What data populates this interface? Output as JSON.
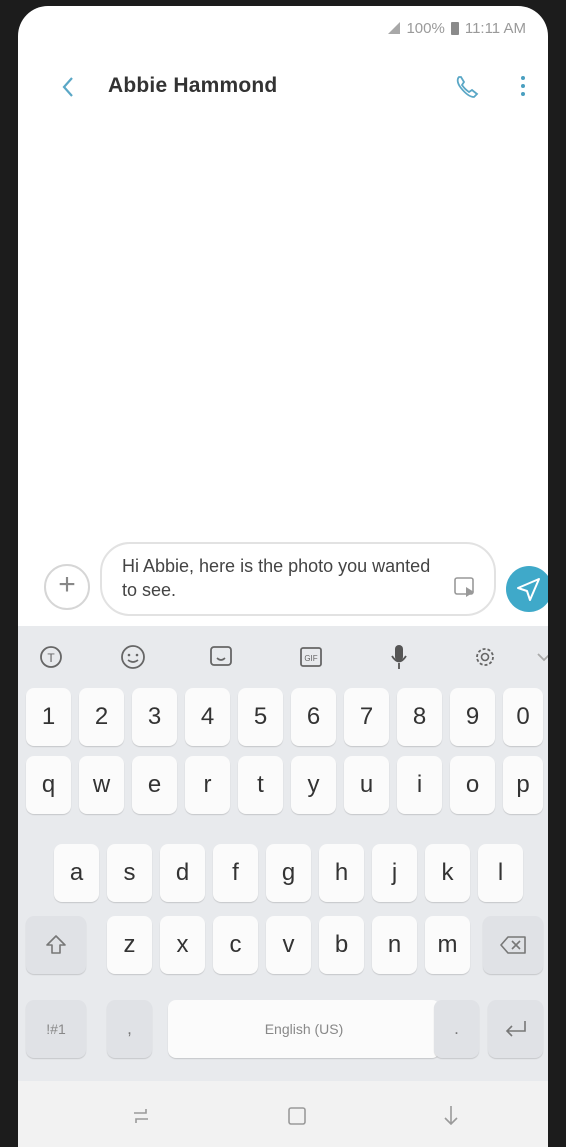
{
  "status_bar": {
    "battery": "100%",
    "time": "11:11 AM"
  },
  "header": {
    "contact_name": "Abbie Hammond"
  },
  "compose": {
    "message_text": "Hi Abbie, here is the photo you wanted to see."
  },
  "keyboard": {
    "toolbar": [
      "translate-icon",
      "emoji-icon",
      "sticker-icon",
      "gif-icon",
      "mic-icon",
      "settings-icon",
      "collapse-icon"
    ],
    "row_numbers": [
      "1",
      "2",
      "3",
      "4",
      "5",
      "6",
      "7",
      "8",
      "9",
      "0"
    ],
    "row_qwerty": [
      "q",
      "w",
      "e",
      "r",
      "t",
      "y",
      "u",
      "i",
      "o",
      "p"
    ],
    "row_asdf": [
      "a",
      "s",
      "d",
      "f",
      "g",
      "h",
      "j",
      "k",
      "l"
    ],
    "row_zxcv": [
      "z",
      "x",
      "c",
      "v",
      "b",
      "n",
      "m"
    ],
    "symbols_label": "!#1",
    "comma_label": ",",
    "space_label": "English (US)",
    "period_label": "."
  },
  "colors": {
    "accent": "#3fa9c9",
    "keyboard_bg": "#e8eaed"
  }
}
